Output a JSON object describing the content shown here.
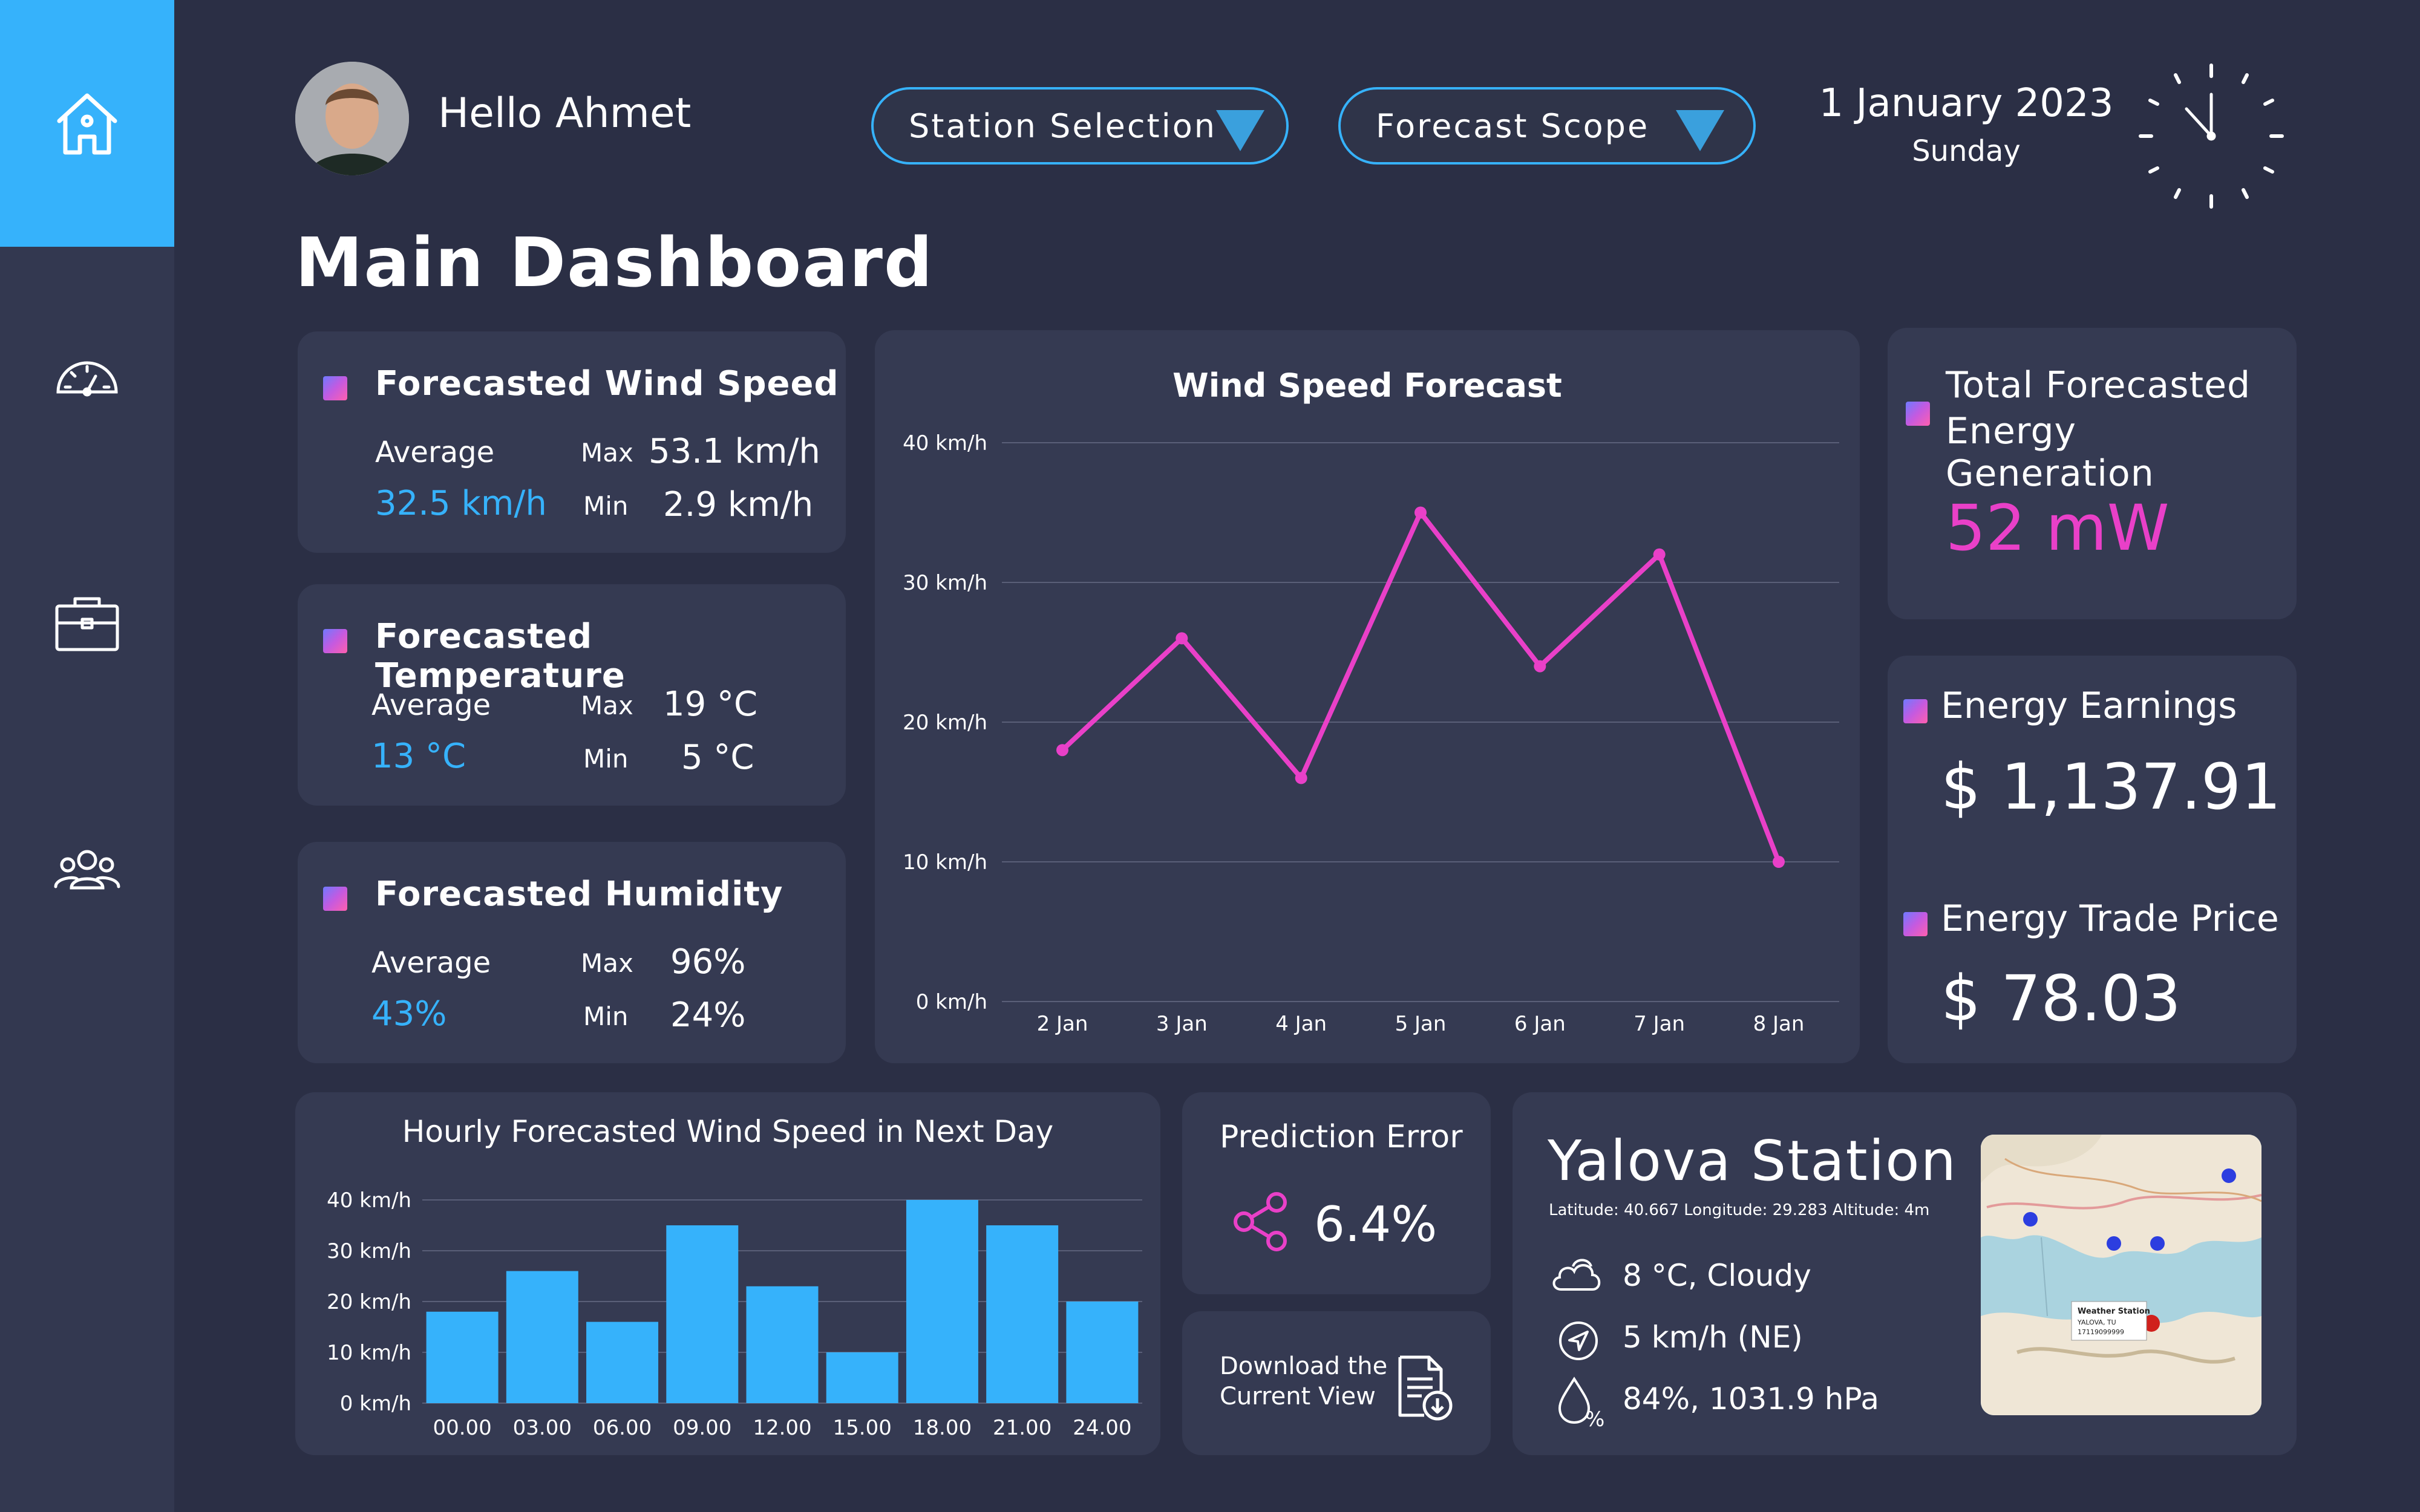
{
  "nav": {
    "items": [
      {
        "icon": "home-icon",
        "active": true
      },
      {
        "icon": "speedometer-icon",
        "active": false
      },
      {
        "icon": "briefcase-icon",
        "active": false
      },
      {
        "icon": "users-icon",
        "active": false
      }
    ],
    "active_color": "#36b2fb"
  },
  "header": {
    "greeting": "Hello Ahmet",
    "station_selection": "Station Selection",
    "forecast_scope": "Forecast Scope",
    "date": "1 January 2023",
    "weekday": "Sunday",
    "page_title": "Main Dashboard"
  },
  "wind_card": {
    "title": "Forecasted Wind Speed",
    "average_label": "Average",
    "average": "32.5 km/h",
    "max_label": "Max",
    "max": "53.1 km/h",
    "min_label": "Min",
    "min": "2.9 km/h"
  },
  "temp_card": {
    "title": "Forecasted Temperature",
    "average_label": "Average",
    "average": "13 °C",
    "max_label": "Max",
    "max": "19 °C",
    "min_label": "Min",
    "min": "5 °C"
  },
  "humidity_card": {
    "title": "Forecasted Humidity",
    "average_label": "Average",
    "average": "43%",
    "max_label": "Max",
    "max": "96%",
    "min_label": "Min",
    "min": "24%"
  },
  "energy": {
    "total_title_line1": "Total Forecasted",
    "total_title_line2": "Energy Generation",
    "total_value": "52 mW",
    "earnings_title": "Energy Earnings",
    "earnings_value": "$ 1,137.91",
    "trade_title": "Energy Trade Price",
    "trade_value": "$ 78.03"
  },
  "prediction": {
    "title": "Prediction Error",
    "value": "6.4%",
    "download_line1": "Download the",
    "download_line2": "Current View"
  },
  "station": {
    "name": "Yalova Station",
    "coords": "Latitude: 40.667 Longitude: 29.283 Altitude: 4m",
    "weather": "8 °C, Cloudy",
    "wind": "5 km/h (NE)",
    "humidity_pressure": "84%,  1031.9 hPa",
    "map_popup_title": "Weather Station",
    "map_popup_line1": "YALOVA, TU",
    "map_popup_line2": "17119099999"
  },
  "colors": {
    "background": "#2b2f45",
    "card": "#353a52",
    "accent_blue": "#36b2fb",
    "accent_pink": "#e940c8"
  },
  "chart_data": [
    {
      "type": "line",
      "title": "Wind Speed Forecast",
      "categories": [
        "2 Jan",
        "3 Jan",
        "4 Jan",
        "5 Jan",
        "6 Jan",
        "7 Jan",
        "8 Jan"
      ],
      "values": [
        18,
        26,
        16,
        35,
        24,
        32,
        10
      ],
      "ylim": [
        0,
        40
      ],
      "yticks": [
        0,
        10,
        20,
        30,
        40
      ],
      "ytick_labels": [
        "0 km/h",
        "10 km/h",
        "20 km/h",
        "30 km/h",
        "40 km/h"
      ],
      "color": "#e940c8",
      "grid": true
    },
    {
      "type": "bar",
      "title": "Hourly Forecasted Wind Speed in Next Day",
      "categories": [
        "00.00",
        "03.00",
        "06.00",
        "09.00",
        "12.00",
        "15.00",
        "18.00",
        "21.00",
        "24.00"
      ],
      "values": [
        18,
        26,
        16,
        35,
        23,
        10,
        40,
        35,
        20
      ],
      "ylim": [
        0,
        40
      ],
      "yticks": [
        0,
        10,
        20,
        30,
        40
      ],
      "ytick_labels": [
        "0 km/h",
        "10 km/h",
        "20 km/h",
        "30 km/h",
        "40 km/h"
      ],
      "color": "#36b2fb",
      "grid": true
    }
  ]
}
